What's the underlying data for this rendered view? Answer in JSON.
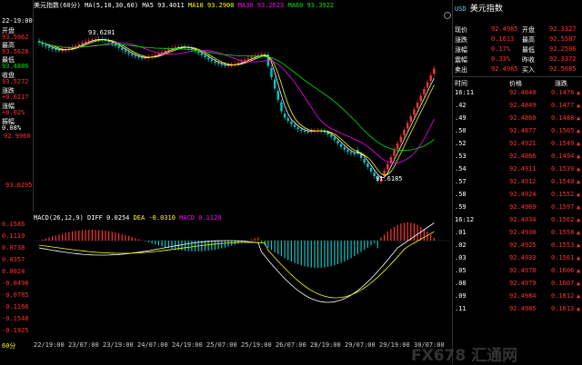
{
  "title_bar": {
    "symbol": "美元指数(60分)",
    "ma_label": "MA(5,10,30,60)",
    "ma5": "MA5 93.4011",
    "ma10": "MA10 93.2900",
    "ma30": "MA30 93.2623",
    "ma60": "MA60 93.3922"
  },
  "left_panel": {
    "time": "22-19:00",
    "open_label": "开盘",
    "open_value": "93.5062",
    "high_label": "最高",
    "high_value": "93.5628",
    "low_label": "最低",
    "low_value": "93.4886",
    "close_label": "收盘",
    "close_value": "93.5272",
    "chg_label": "涨跌",
    "chg_value": "+0.0217",
    "pct_label": "涨幅",
    "pct_value": "+0.02%",
    "amp_label": "振幅",
    "amp_value": "0.08%",
    "axis_low": "92.9960",
    "axis_lower": "93.0295"
  },
  "annotations": {
    "high_marker": "93.6281",
    "low_marker": "91.6185"
  },
  "macd_bar": {
    "label": "MACD(26,12,9)",
    "diff": "DIFF 0.0254",
    "dea": "DEA -0.0310",
    "macd": "MACD 0.1128",
    "yticks": [
      "0.1586",
      "0.1119",
      "0.0738",
      "0.0357",
      "0.0024",
      "-0.0498",
      "-0.0785",
      "-0.1166",
      "-0.1548",
      "-0.1925"
    ]
  },
  "x_axis": {
    "period": "60分",
    "ticks": [
      "22/19:00",
      "23/07:00",
      "23/19:00",
      "24/07:00",
      "24/19:00",
      "25/07:00",
      "25/19:00",
      "26/07:00",
      "28/19:00",
      "29/07:00",
      "29/19:00",
      "30/07:00"
    ]
  },
  "right_panel": {
    "currency": "USD",
    "name": "美元指数",
    "quotes": [
      {
        "l1": "现价",
        "v1": "92.4985",
        "l2": "开盘",
        "v2": "92.3327"
      },
      {
        "l1": "涨跌",
        "v1": "0.1613",
        "l2": "最高",
        "v2": "92.5587"
      },
      {
        "l1": "涨幅",
        "v1": "0.17%",
        "l2": "最低",
        "v2": "92.2586"
      },
      {
        "l1": "震幅",
        "v1": "0.33%",
        "l2": "昨收",
        "v2": "92.3372"
      },
      {
        "l1": "卖出",
        "v1": "92.4985",
        "l2": "买入",
        "v2": "92.5085"
      }
    ],
    "tick_headers": [
      "时间",
      "价格",
      "涨跌"
    ],
    "ticks": [
      {
        "t": "16:11",
        "p": "92.4840",
        "c": "0.1476"
      },
      {
        "t": ".42",
        "p": "92.4849",
        "c": "0.1477"
      },
      {
        "t": ".49",
        "p": "92.4860",
        "c": "0.1488"
      },
      {
        "t": ".50",
        "p": "92.4877",
        "c": "0.1505"
      },
      {
        "t": ".52",
        "p": "92.4921",
        "c": "0.1549"
      },
      {
        "t": ".53",
        "p": "92.4866",
        "c": "0.1494"
      },
      {
        "t": ".54",
        "p": "92.4911",
        "c": "0.1539"
      },
      {
        "t": ".57",
        "p": "92.4912",
        "c": "0.1540"
      },
      {
        "t": ".58",
        "p": "92.4924",
        "c": "0.1552"
      },
      {
        "t": ".59",
        "p": "92.4969",
        "c": "0.1597"
      },
      {
        "t": "16:12",
        "p": "92.4934",
        "c": "0.1562"
      },
      {
        "t": ".01",
        "p": "92.4930",
        "c": "0.1558"
      },
      {
        "t": ".02",
        "p": "92.4925",
        "c": "0.1553"
      },
      {
        "t": ".03",
        "p": "92.4933",
        "c": "0.1561"
      },
      {
        "t": ".05",
        "p": "92.4978",
        "c": "0.1606"
      },
      {
        "t": ".08",
        "p": "92.4979",
        "c": "0.1607"
      },
      {
        "t": ".09",
        "p": "92.4984",
        "c": "0.1612"
      },
      {
        "t": ".11",
        "p": "92.4985",
        "c": "0.1613"
      }
    ]
  },
  "watermark": "FX678 汇通网",
  "colors": {
    "up": "#ff3232",
    "down": "#00c8c8",
    "ma5": "#ffffff",
    "ma10": "#ffff00",
    "ma30": "#ff00ff",
    "ma60": "#00e600",
    "bg": "#000000"
  }
}
